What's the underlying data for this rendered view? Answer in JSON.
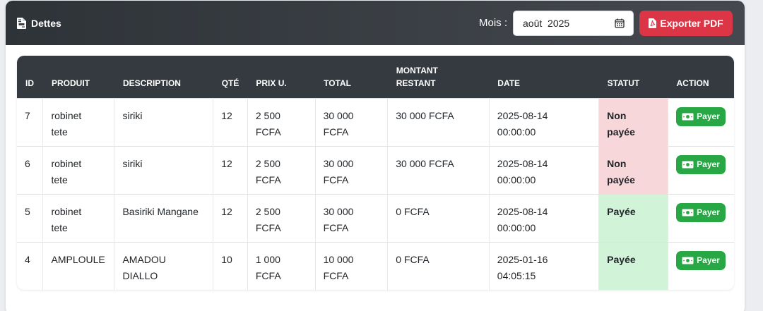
{
  "header": {
    "title": "Dettes",
    "mois_label": "Mois :",
    "mois_value": "août  2025",
    "export_label": "Exporter PDF"
  },
  "table": {
    "columns": {
      "id": "ID",
      "produit": "PRODUIT",
      "description": "DESCRIPTION",
      "qte": "QTÉ",
      "prix": "PRIX U.",
      "total": "TOTAL",
      "montant_1": "MONTANT",
      "montant_2": "RESTANT",
      "date": "DATE",
      "statut": "STATUT",
      "action": "ACTION"
    },
    "rows": [
      {
        "id": "7",
        "produit_1": "robinet",
        "produit_2": "tete",
        "description_1": "siriki",
        "description_2": "",
        "qte": "12",
        "prix_1": "2 500",
        "prix_2": "FCFA",
        "total_1": "30 000",
        "total_2": "FCFA",
        "restant": "30 000 FCFA",
        "date_1": "2025-08-14",
        "date_2": "00:00:00",
        "statut_1": "Non",
        "statut_2": "payée",
        "action": "Payer"
      },
      {
        "id": "6",
        "produit_1": "robinet",
        "produit_2": "tete",
        "description_1": "siriki",
        "description_2": "",
        "qte": "12",
        "prix_1": "2 500",
        "prix_2": "FCFA",
        "total_1": "30 000",
        "total_2": "FCFA",
        "restant": "30 000 FCFA",
        "date_1": "2025-08-14",
        "date_2": "00:00:00",
        "statut_1": "Non",
        "statut_2": "payée",
        "action": "Payer"
      },
      {
        "id": "5",
        "produit_1": "robinet",
        "produit_2": "tete",
        "description_1": "Basiriki Mangane",
        "description_2": "",
        "qte": "12",
        "prix_1": "2 500",
        "prix_2": "FCFA",
        "total_1": "30 000",
        "total_2": "FCFA",
        "restant": "0 FCFA",
        "date_1": "2025-08-14",
        "date_2": "00:00:00",
        "statut_1": "Payée",
        "statut_2": "",
        "action": "Payer"
      },
      {
        "id": "4",
        "produit_1": "AMPLOULE",
        "produit_2": "",
        "description_1": "AMADOU",
        "description_2": "DIALLO",
        "qte": "10",
        "prix_1": "1 000",
        "prix_2": "FCFA",
        "total_1": "10 000",
        "total_2": "FCFA",
        "restant": "0 FCFA",
        "date_1": "2025-01-16",
        "date_2": "04:05:15",
        "statut_1": "Payée",
        "statut_2": "",
        "action": "Payer"
      }
    ]
  },
  "colors": {
    "header_bg": "#343a40",
    "danger": "#dc3545",
    "success": "#28a745",
    "unpaid_bg": "#f8d7da",
    "paid_bg": "#d1f4d8"
  },
  "icons": {
    "title": "file-invoice-icon",
    "calendar": "calendar-icon",
    "pdf": "file-pdf-icon",
    "payer": "money-bill-icon"
  }
}
